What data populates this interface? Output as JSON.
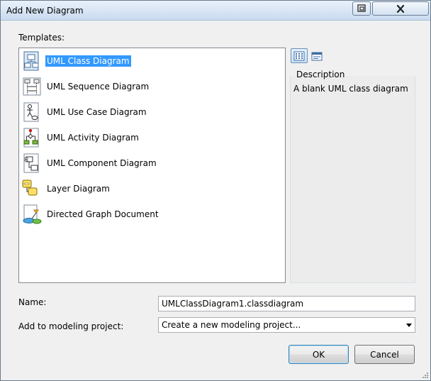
{
  "window": {
    "title": "Add New Diagram",
    "help_icon": "help-icon",
    "close_icon": "close-icon"
  },
  "templates": {
    "label": "Templates:",
    "items": [
      {
        "label": "UML Class Diagram",
        "icon": "uml-class-diagram-icon",
        "selected": true
      },
      {
        "label": "UML Sequence Diagram",
        "icon": "uml-sequence-diagram-icon",
        "selected": false
      },
      {
        "label": "UML Use Case Diagram",
        "icon": "uml-use-case-diagram-icon",
        "selected": false
      },
      {
        "label": "UML Activity Diagram",
        "icon": "uml-activity-diagram-icon",
        "selected": false
      },
      {
        "label": "UML Component Diagram",
        "icon": "uml-component-diagram-icon",
        "selected": false
      },
      {
        "label": "Layer Diagram",
        "icon": "layer-diagram-icon",
        "selected": false
      },
      {
        "label": "Directed Graph Document",
        "icon": "directed-graph-icon",
        "selected": false
      }
    ]
  },
  "view_toggle": {
    "large_icons": "large-icons-view-icon",
    "small_icons": "list-view-icon",
    "active": "large"
  },
  "description": {
    "header": "Description",
    "text": "A blank UML class diagram"
  },
  "name_field": {
    "label": "Name:",
    "value": "UMLClassDiagram1.classdiagram"
  },
  "project_field": {
    "label": "Add to modeling project:",
    "value": "Create a new modeling project..."
  },
  "buttons": {
    "ok": "OK",
    "cancel": "Cancel"
  },
  "colors": {
    "selection": "#3399ff",
    "titlebar": "#c9dbef"
  }
}
